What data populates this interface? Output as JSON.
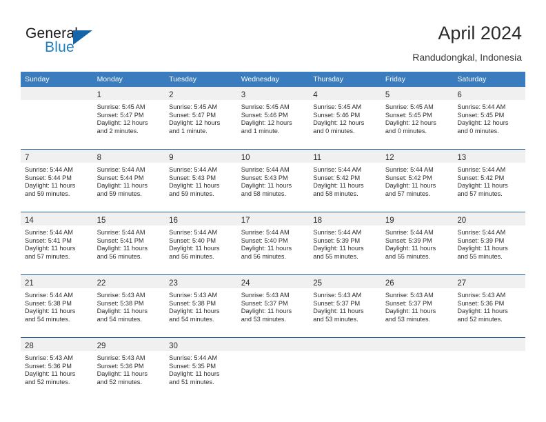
{
  "brand": {
    "name_part1": "General",
    "name_part2": "Blue",
    "accent_color": "#1f7ec2",
    "triangle_color": "#1565a8"
  },
  "header": {
    "title": "April 2024",
    "location": "Randudongkal, Indonesia"
  },
  "theme": {
    "header_bg": "#3a7cbd",
    "header_text": "#ffffff",
    "week_separator": "#1f5f9e",
    "daynum_strip_bg": "#f0f0f0",
    "cell_bg": "#ffffff",
    "text": "#2c2c2c"
  },
  "weekdays": [
    "Sunday",
    "Monday",
    "Tuesday",
    "Wednesday",
    "Thursday",
    "Friday",
    "Saturday"
  ],
  "labels": {
    "sunrise_prefix": "Sunrise:",
    "sunset_prefix": "Sunset:",
    "daylight_prefix": "Daylight:"
  },
  "weeks": [
    [
      {
        "day": "",
        "sunrise": "",
        "sunset": "",
        "daylight_line1": "",
        "daylight_line2": ""
      },
      {
        "day": "1",
        "sunrise": "Sunrise: 5:45 AM",
        "sunset": "Sunset: 5:47 PM",
        "daylight_line1": "Daylight: 12 hours",
        "daylight_line2": "and 2 minutes."
      },
      {
        "day": "2",
        "sunrise": "Sunrise: 5:45 AM",
        "sunset": "Sunset: 5:47 PM",
        "daylight_line1": "Daylight: 12 hours",
        "daylight_line2": "and 1 minute."
      },
      {
        "day": "3",
        "sunrise": "Sunrise: 5:45 AM",
        "sunset": "Sunset: 5:46 PM",
        "daylight_line1": "Daylight: 12 hours",
        "daylight_line2": "and 1 minute."
      },
      {
        "day": "4",
        "sunrise": "Sunrise: 5:45 AM",
        "sunset": "Sunset: 5:46 PM",
        "daylight_line1": "Daylight: 12 hours",
        "daylight_line2": "and 0 minutes."
      },
      {
        "day": "5",
        "sunrise": "Sunrise: 5:45 AM",
        "sunset": "Sunset: 5:45 PM",
        "daylight_line1": "Daylight: 12 hours",
        "daylight_line2": "and 0 minutes."
      },
      {
        "day": "6",
        "sunrise": "Sunrise: 5:44 AM",
        "sunset": "Sunset: 5:45 PM",
        "daylight_line1": "Daylight: 12 hours",
        "daylight_line2": "and 0 minutes."
      }
    ],
    [
      {
        "day": "7",
        "sunrise": "Sunrise: 5:44 AM",
        "sunset": "Sunset: 5:44 PM",
        "daylight_line1": "Daylight: 11 hours",
        "daylight_line2": "and 59 minutes."
      },
      {
        "day": "8",
        "sunrise": "Sunrise: 5:44 AM",
        "sunset": "Sunset: 5:44 PM",
        "daylight_line1": "Daylight: 11 hours",
        "daylight_line2": "and 59 minutes."
      },
      {
        "day": "9",
        "sunrise": "Sunrise: 5:44 AM",
        "sunset": "Sunset: 5:43 PM",
        "daylight_line1": "Daylight: 11 hours",
        "daylight_line2": "and 59 minutes."
      },
      {
        "day": "10",
        "sunrise": "Sunrise: 5:44 AM",
        "sunset": "Sunset: 5:43 PM",
        "daylight_line1": "Daylight: 11 hours",
        "daylight_line2": "and 58 minutes."
      },
      {
        "day": "11",
        "sunrise": "Sunrise: 5:44 AM",
        "sunset": "Sunset: 5:42 PM",
        "daylight_line1": "Daylight: 11 hours",
        "daylight_line2": "and 58 minutes."
      },
      {
        "day": "12",
        "sunrise": "Sunrise: 5:44 AM",
        "sunset": "Sunset: 5:42 PM",
        "daylight_line1": "Daylight: 11 hours",
        "daylight_line2": "and 57 minutes."
      },
      {
        "day": "13",
        "sunrise": "Sunrise: 5:44 AM",
        "sunset": "Sunset: 5:42 PM",
        "daylight_line1": "Daylight: 11 hours",
        "daylight_line2": "and 57 minutes."
      }
    ],
    [
      {
        "day": "14",
        "sunrise": "Sunrise: 5:44 AM",
        "sunset": "Sunset: 5:41 PM",
        "daylight_line1": "Daylight: 11 hours",
        "daylight_line2": "and 57 minutes."
      },
      {
        "day": "15",
        "sunrise": "Sunrise: 5:44 AM",
        "sunset": "Sunset: 5:41 PM",
        "daylight_line1": "Daylight: 11 hours",
        "daylight_line2": "and 56 minutes."
      },
      {
        "day": "16",
        "sunrise": "Sunrise: 5:44 AM",
        "sunset": "Sunset: 5:40 PM",
        "daylight_line1": "Daylight: 11 hours",
        "daylight_line2": "and 56 minutes."
      },
      {
        "day": "17",
        "sunrise": "Sunrise: 5:44 AM",
        "sunset": "Sunset: 5:40 PM",
        "daylight_line1": "Daylight: 11 hours",
        "daylight_line2": "and 56 minutes."
      },
      {
        "day": "18",
        "sunrise": "Sunrise: 5:44 AM",
        "sunset": "Sunset: 5:39 PM",
        "daylight_line1": "Daylight: 11 hours",
        "daylight_line2": "and 55 minutes."
      },
      {
        "day": "19",
        "sunrise": "Sunrise: 5:44 AM",
        "sunset": "Sunset: 5:39 PM",
        "daylight_line1": "Daylight: 11 hours",
        "daylight_line2": "and 55 minutes."
      },
      {
        "day": "20",
        "sunrise": "Sunrise: 5:44 AM",
        "sunset": "Sunset: 5:39 PM",
        "daylight_line1": "Daylight: 11 hours",
        "daylight_line2": "and 55 minutes."
      }
    ],
    [
      {
        "day": "21",
        "sunrise": "Sunrise: 5:44 AM",
        "sunset": "Sunset: 5:38 PM",
        "daylight_line1": "Daylight: 11 hours",
        "daylight_line2": "and 54 minutes."
      },
      {
        "day": "22",
        "sunrise": "Sunrise: 5:43 AM",
        "sunset": "Sunset: 5:38 PM",
        "daylight_line1": "Daylight: 11 hours",
        "daylight_line2": "and 54 minutes."
      },
      {
        "day": "23",
        "sunrise": "Sunrise: 5:43 AM",
        "sunset": "Sunset: 5:38 PM",
        "daylight_line1": "Daylight: 11 hours",
        "daylight_line2": "and 54 minutes."
      },
      {
        "day": "24",
        "sunrise": "Sunrise: 5:43 AM",
        "sunset": "Sunset: 5:37 PM",
        "daylight_line1": "Daylight: 11 hours",
        "daylight_line2": "and 53 minutes."
      },
      {
        "day": "25",
        "sunrise": "Sunrise: 5:43 AM",
        "sunset": "Sunset: 5:37 PM",
        "daylight_line1": "Daylight: 11 hours",
        "daylight_line2": "and 53 minutes."
      },
      {
        "day": "26",
        "sunrise": "Sunrise: 5:43 AM",
        "sunset": "Sunset: 5:37 PM",
        "daylight_line1": "Daylight: 11 hours",
        "daylight_line2": "and 53 minutes."
      },
      {
        "day": "27",
        "sunrise": "Sunrise: 5:43 AM",
        "sunset": "Sunset: 5:36 PM",
        "daylight_line1": "Daylight: 11 hours",
        "daylight_line2": "and 52 minutes."
      }
    ],
    [
      {
        "day": "28",
        "sunrise": "Sunrise: 5:43 AM",
        "sunset": "Sunset: 5:36 PM",
        "daylight_line1": "Daylight: 11 hours",
        "daylight_line2": "and 52 minutes."
      },
      {
        "day": "29",
        "sunrise": "Sunrise: 5:43 AM",
        "sunset": "Sunset: 5:36 PM",
        "daylight_line1": "Daylight: 11 hours",
        "daylight_line2": "and 52 minutes."
      },
      {
        "day": "30",
        "sunrise": "Sunrise: 5:44 AM",
        "sunset": "Sunset: 5:35 PM",
        "daylight_line1": "Daylight: 11 hours",
        "daylight_line2": "and 51 minutes."
      },
      {
        "day": "",
        "sunrise": "",
        "sunset": "",
        "daylight_line1": "",
        "daylight_line2": ""
      },
      {
        "day": "",
        "sunrise": "",
        "sunset": "",
        "daylight_line1": "",
        "daylight_line2": ""
      },
      {
        "day": "",
        "sunrise": "",
        "sunset": "",
        "daylight_line1": "",
        "daylight_line2": ""
      },
      {
        "day": "",
        "sunrise": "",
        "sunset": "",
        "daylight_line1": "",
        "daylight_line2": ""
      }
    ]
  ]
}
